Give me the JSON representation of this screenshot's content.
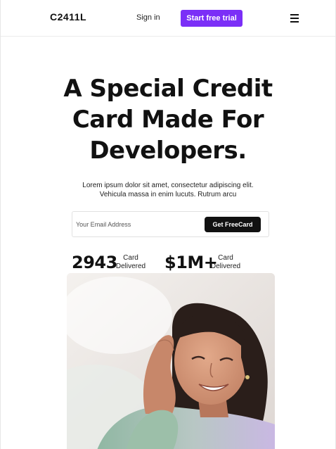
{
  "header": {
    "logo": "C2411L",
    "signin_label": "Sign in",
    "cta_label": "Start free trial",
    "menu_icon": "hamburger-menu-icon"
  },
  "hero": {
    "title_line1": "A Special Credit",
    "title_line2": "Card Made For",
    "title_line3": "Developers.",
    "subtitle_line1": "Lorem ipsum dolor sit amet, consectetur adipiscing elit.",
    "subtitle_line2": "Vehicula massa in enim lucuts. Rutrum arcu"
  },
  "signup": {
    "email_placeholder": "Your Email Address",
    "email_value": "",
    "button_label": "Get FreeCard"
  },
  "stats": [
    {
      "value": "2943",
      "label_line1": "Card",
      "label_line2": "Delivered"
    },
    {
      "value": "$1M+",
      "label_line1": "Card",
      "label_line2": "Delivered"
    }
  ],
  "colors": {
    "accent": "#7b2ff7",
    "dark_button": "#111111"
  }
}
